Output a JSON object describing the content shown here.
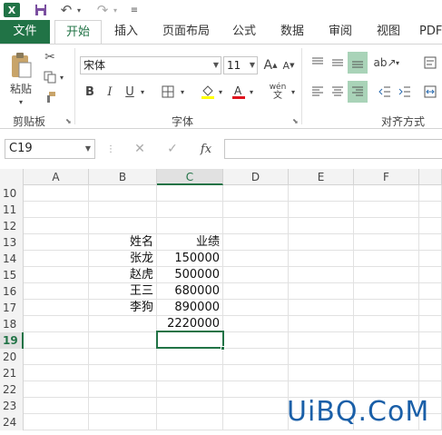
{
  "app": {
    "title": "Excel"
  },
  "qab": {
    "logo": "X",
    "undo_icon": "undo-icon",
    "redo_icon": "redo-icon",
    "save_icon": "save-icon"
  },
  "tabs": [
    {
      "label": "文件"
    },
    {
      "label": "开始"
    },
    {
      "label": "插入"
    },
    {
      "label": "页面布局"
    },
    {
      "label": "公式"
    },
    {
      "label": "数据"
    },
    {
      "label": "审阅"
    },
    {
      "label": "视图"
    },
    {
      "label": "PDF"
    }
  ],
  "ribbon": {
    "clipboard": {
      "label": "剪贴板",
      "paste_label": "粘贴"
    },
    "font": {
      "label": "字体",
      "font_name": "宋体",
      "font_size": "11",
      "bold": "B",
      "italic": "I",
      "underline": "U",
      "grow": "A",
      "shrink": "A",
      "phonetic": "wén"
    },
    "alignment": {
      "label": "对齐方式"
    }
  },
  "formula_bar": {
    "name_box": "C19",
    "cancel": "✕",
    "enter": "✓",
    "fx": "fx",
    "value": ""
  },
  "grid": {
    "columns": [
      "A",
      "B",
      "C",
      "D",
      "E",
      "F"
    ],
    "selected_column": "C",
    "selected_row": "19",
    "rows": [
      {
        "num": "10",
        "b": "",
        "c": ""
      },
      {
        "num": "11",
        "b": "",
        "c": ""
      },
      {
        "num": "12",
        "b": "",
        "c": ""
      },
      {
        "num": "13",
        "b": "姓名",
        "c": "业绩"
      },
      {
        "num": "14",
        "b": "张龙",
        "c": "150000"
      },
      {
        "num": "15",
        "b": "赵虎",
        "c": "500000"
      },
      {
        "num": "16",
        "b": "王三",
        "c": "680000"
      },
      {
        "num": "17",
        "b": "李狗",
        "c": "890000"
      },
      {
        "num": "18",
        "b": "",
        "c": "2220000"
      },
      {
        "num": "19",
        "b": "",
        "c": ""
      },
      {
        "num": "20",
        "b": "",
        "c": ""
      },
      {
        "num": "21",
        "b": "",
        "c": ""
      },
      {
        "num": "22",
        "b": "",
        "c": ""
      },
      {
        "num": "23",
        "b": "",
        "c": ""
      },
      {
        "num": "24",
        "b": "",
        "c": ""
      }
    ]
  },
  "watermark": "UiBQ.CoM",
  "colors": {
    "accent": "#217346",
    "watermark": "#1a5fa8",
    "align_active": "#a9d3b8"
  }
}
